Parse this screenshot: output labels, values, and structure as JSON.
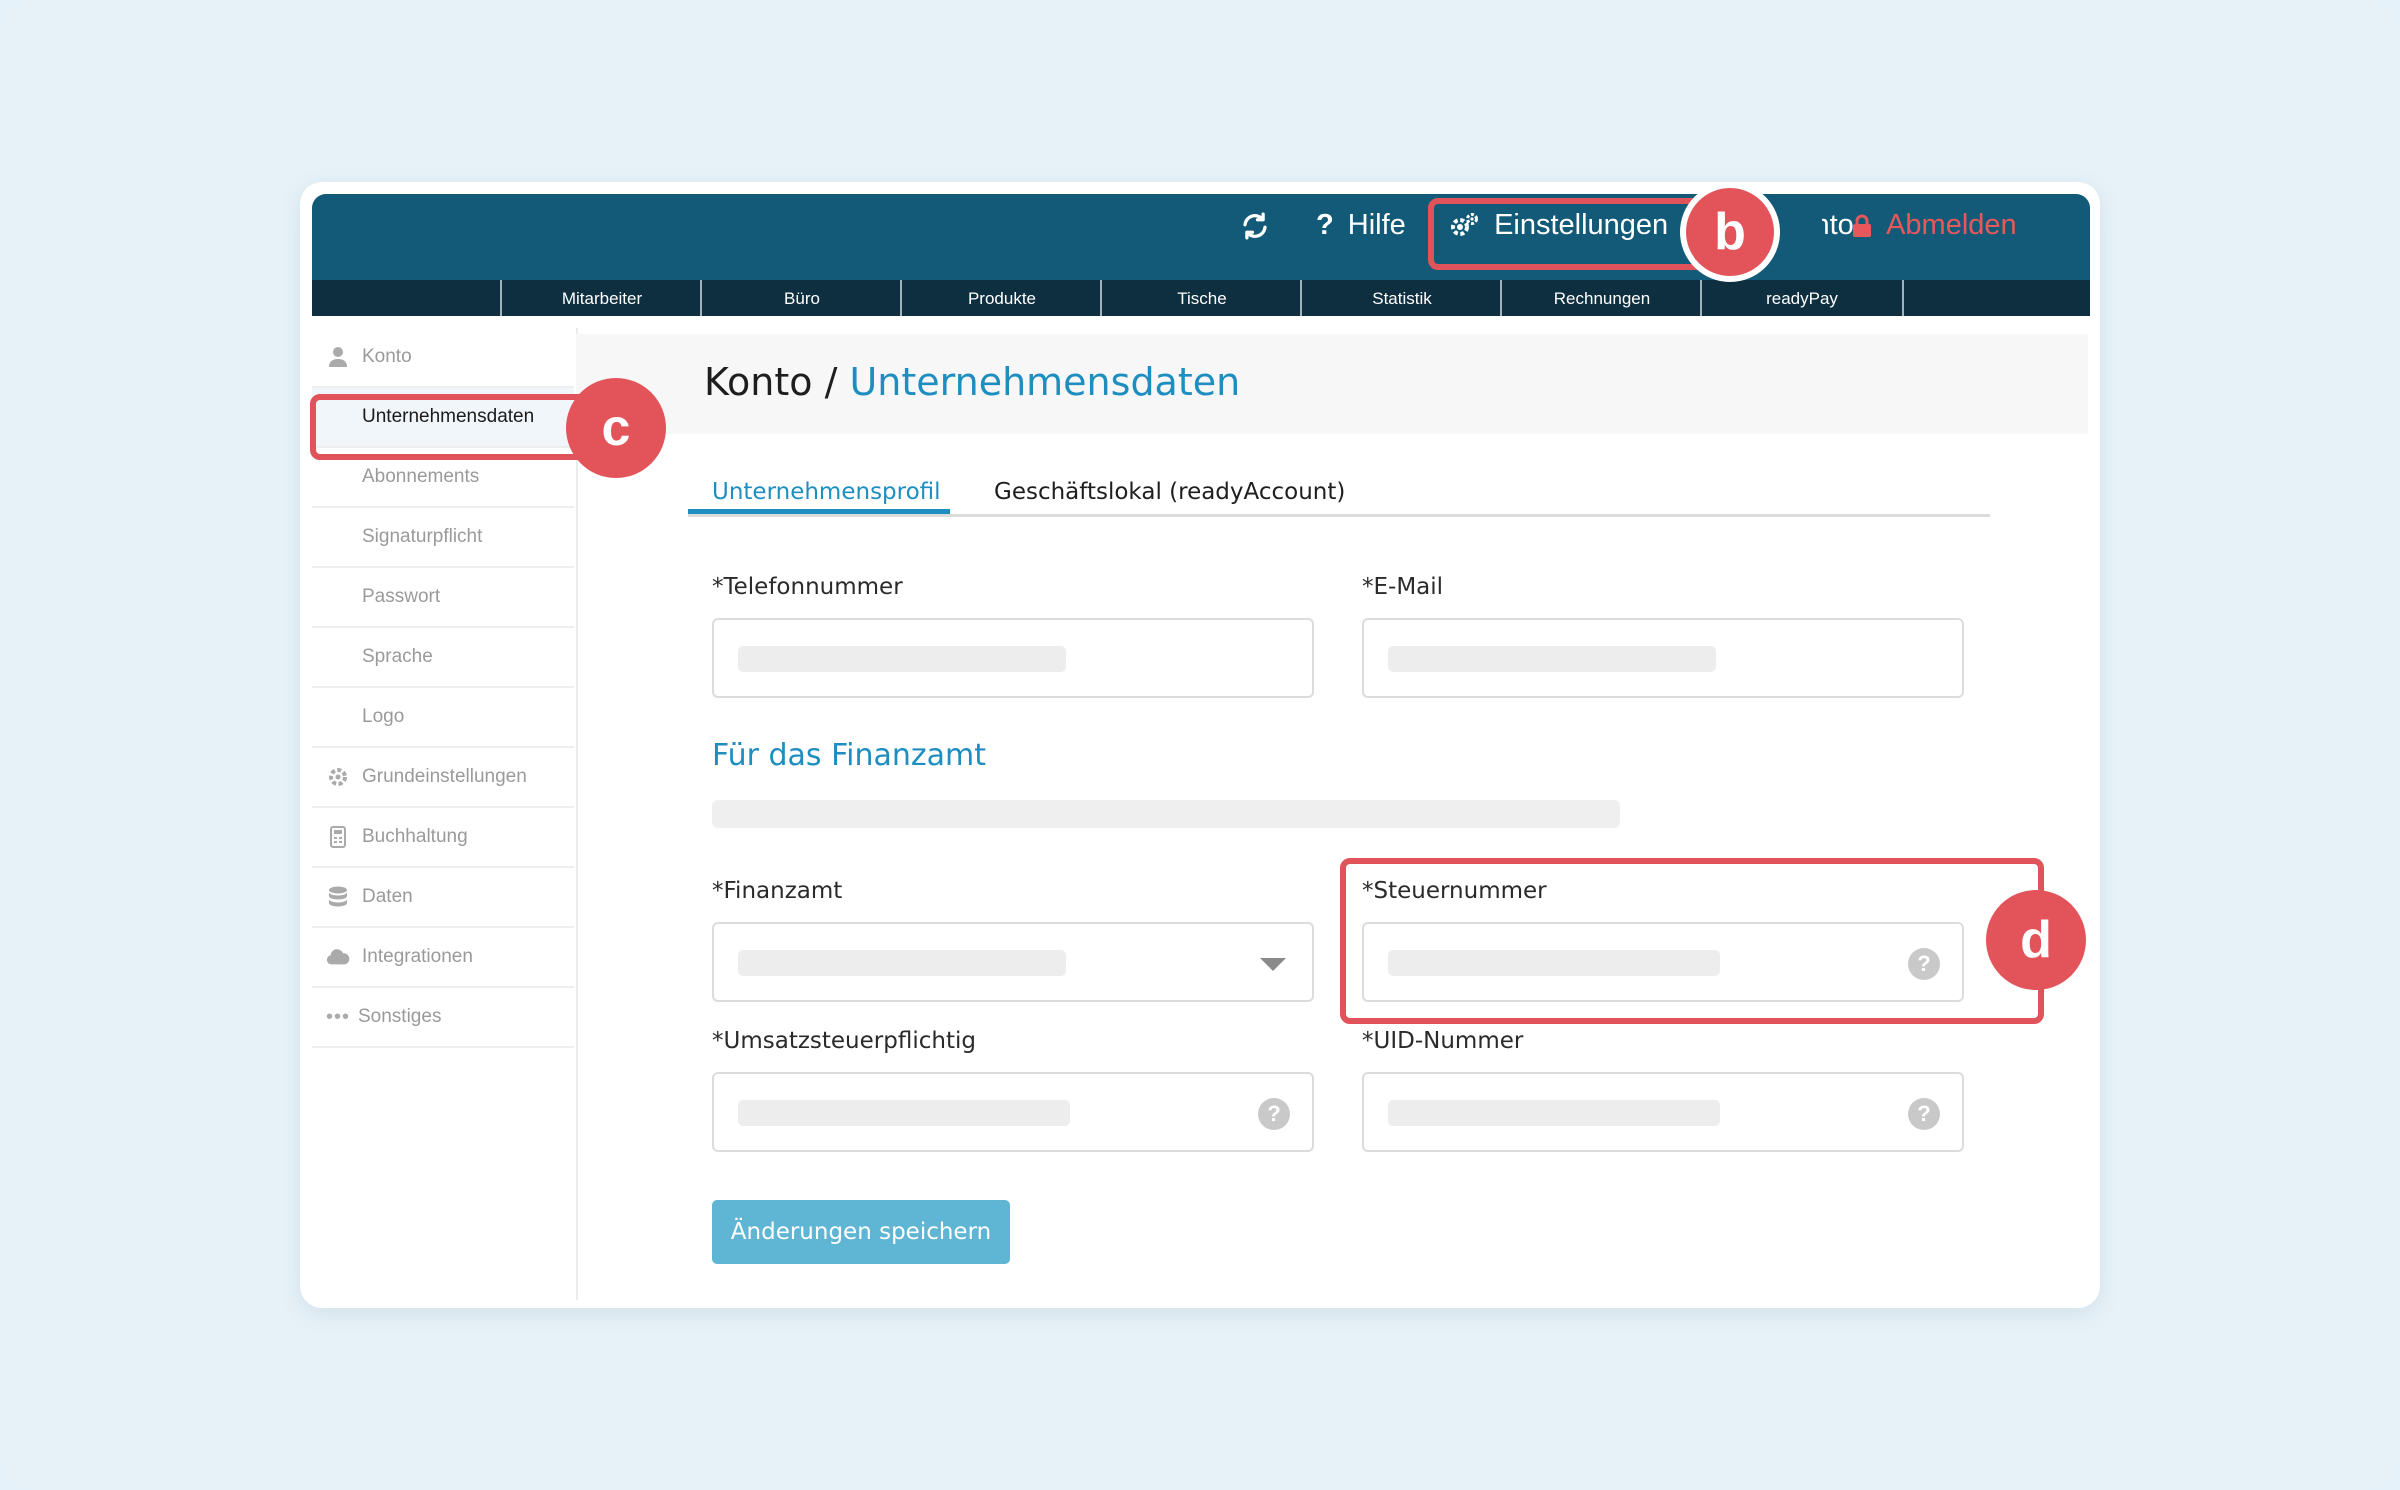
{
  "topbar": {
    "refresh_icon": "refresh-icon",
    "help_label": "Hilfe",
    "settings_label": "Einstellungen",
    "konto_label": "Konto",
    "logout_label": "Abmelden",
    "colors": {
      "bar": "#135a78",
      "logout": "#e8585a"
    }
  },
  "nav": {
    "items": [
      "Mitarbeiter",
      "Büro",
      "Produkte",
      "Tische",
      "Statistik",
      "Rechnungen",
      "readyPay"
    ]
  },
  "callouts": {
    "b": "b",
    "c": "c",
    "d": "d",
    "color": "#e0535a"
  },
  "sidebar": {
    "items": [
      {
        "label": "Konto",
        "icon": "user-icon"
      },
      {
        "label": "Unternehmensdaten",
        "icon": ""
      },
      {
        "label": "Abonnements",
        "icon": ""
      },
      {
        "label": "Signaturpflicht",
        "icon": ""
      },
      {
        "label": "Passwort",
        "icon": ""
      },
      {
        "label": "Sprache",
        "icon": ""
      },
      {
        "label": "Logo",
        "icon": ""
      },
      {
        "label": "Grundeinstellungen",
        "icon": "gear-icon"
      },
      {
        "label": "Buchhaltung",
        "icon": "calculator-icon"
      },
      {
        "label": "Daten",
        "icon": "database-icon"
      },
      {
        "label": "Integrationen",
        "icon": "cloud-icon"
      },
      {
        "label": "Sonstiges",
        "icon": "ellipsis-icon"
      }
    ],
    "active": "Unternehmensdaten"
  },
  "page": {
    "breadcrumb_root": "Konto",
    "breadcrumb_sep": " / ",
    "breadcrumb_current": "Unternehmensdaten"
  },
  "tabs": [
    {
      "label": "Unternehmensprofil",
      "active": true
    },
    {
      "label": "Geschäftslokal (readyAccount)",
      "active": false
    }
  ],
  "form": {
    "phone_label": "*Telefonnummer",
    "email_label": "*E-Mail",
    "section_title": "Für das Finanzamt",
    "finanzamt_label": "*Finanzamt",
    "steuernummer_label": "*Steuernummer",
    "umsatz_label": "*Umsatzsteuerpflichtig",
    "uid_label": "*UID-Nummer",
    "help_glyph": "?",
    "save_label": "Änderungen speichern",
    "accent": "#1e8ec0",
    "button_color": "#5fb5d4"
  }
}
